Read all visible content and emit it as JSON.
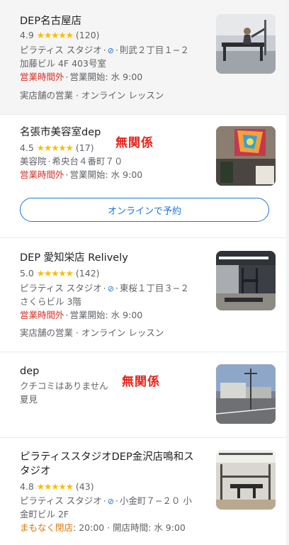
{
  "results": [
    {
      "name": "DEP名古屋店",
      "rating": "4.9",
      "stars": "★★★★★",
      "reviews": "(120)",
      "category": "ピラティス スタジオ",
      "no_delivery_icon": "⊘",
      "address_line1": "則武２丁目１−２",
      "address_line2": "加藤ビル 4F 403号室",
      "status": "営業時間外",
      "hours": "営業開始: 水 9:00",
      "services": "実店舗の営業 · オンライン レッスン"
    },
    {
      "name": "名張市美容室dep",
      "annotation": "無関係",
      "rating": "4.5",
      "stars": "★★★★★",
      "reviews": "(17)",
      "category": "美容院",
      "address_line1": "希央台４番町７０",
      "status": "営業時間外",
      "hours": "営業開始: 水 9:00",
      "button_label": "オンラインで予約"
    },
    {
      "name": "DEP 愛知栄店 Relively",
      "rating": "5.0",
      "stars": "★★★★★",
      "reviews": "(142)",
      "category": "ピラティス スタジオ",
      "address_line1": "東桜１丁目３−２",
      "address_line2": "さくらビル 3階",
      "status": "営業時間外",
      "hours": "営業開始: 水 9:00",
      "services": "実店舗の営業 · オンライン レッスン"
    },
    {
      "name": "dep",
      "annotation": "無関係",
      "reviews_none": "クチコミはありません",
      "area": "夏見"
    },
    {
      "name_line1": "ピラティススタジオDEP金沢店鳴和ス",
      "name_line2": "タジオ",
      "rating": "4.8",
      "stars": "★★★★★",
      "reviews": "(43)",
      "category": "ピラティス スタジオ",
      "address_line1": "小金町７−２０ 小",
      "address_line2": "金町ビル 2F",
      "status": "まもなく閉店",
      "hours": ": 20:00 · 開店時間: 水 9:00"
    }
  ],
  "colors": {
    "closed": "#d93025",
    "closing_soon": "#e37400",
    "star": "#fbbc04",
    "link": "#1a73e8",
    "annotation": "#e8231a"
  }
}
